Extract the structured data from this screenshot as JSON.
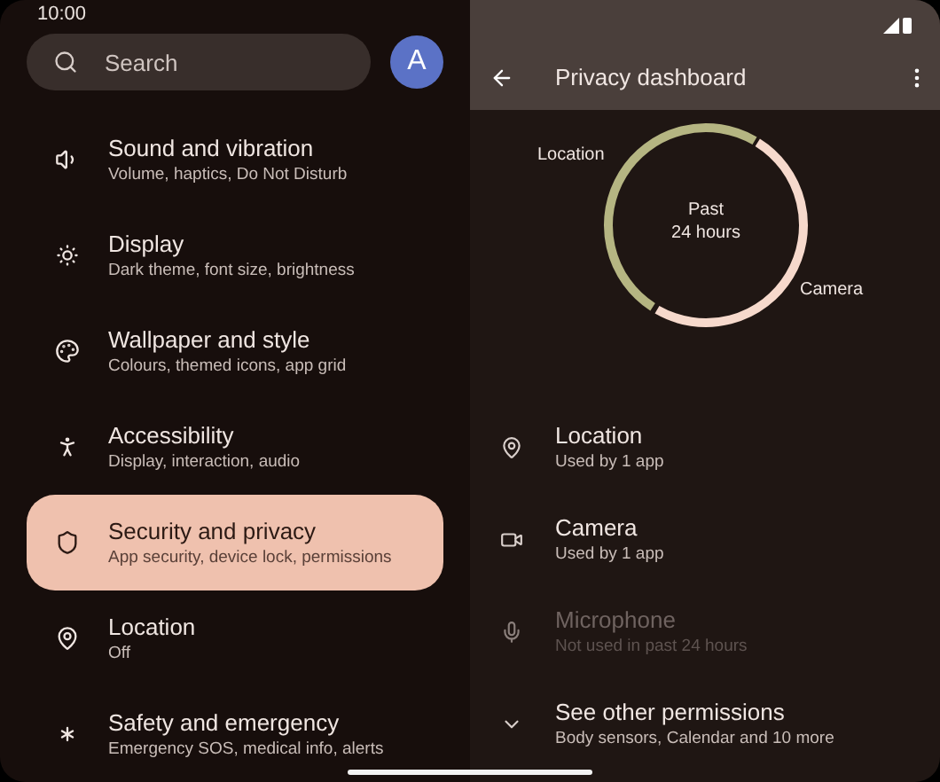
{
  "status_bar": {
    "time": "10:00"
  },
  "search": {
    "placeholder": "Search"
  },
  "avatar": {
    "letter": "A"
  },
  "settings": [
    {
      "title": "Sound and vibration",
      "subtitle": "Volume, haptics, Do Not Disturb",
      "selected": false
    },
    {
      "title": "Display",
      "subtitle": "Dark theme, font size, brightness",
      "selected": false
    },
    {
      "title": "Wallpaper and style",
      "subtitle": "Colours, themed icons, app grid",
      "selected": false
    },
    {
      "title": "Accessibility",
      "subtitle": "Display, interaction, audio",
      "selected": false
    },
    {
      "title": "Security and privacy",
      "subtitle": "App security, device lock, permissions",
      "selected": true
    },
    {
      "title": "Location",
      "subtitle": "Off",
      "selected": false
    },
    {
      "title": "Safety and emergency",
      "subtitle": "Emergency SOS, medical info, alerts",
      "selected": false
    }
  ],
  "detail": {
    "title": "Privacy dashboard",
    "usage_ring": {
      "center_lines": [
        "Past",
        "24 hours"
      ],
      "segments": [
        {
          "label": "Location",
          "color": "#b5b582"
        },
        {
          "label": "Camera",
          "color": "#f6d9cc"
        }
      ]
    },
    "permissions": [
      {
        "title": "Location",
        "subtitle": "Used by 1 app",
        "disabled": false
      },
      {
        "title": "Camera",
        "subtitle": "Used by 1 app",
        "disabled": false
      },
      {
        "title": "Microphone",
        "subtitle": "Not used in past 24 hours",
        "disabled": true
      },
      {
        "title": "See other permissions",
        "subtitle": "Body sensors, Calendar and 10 more",
        "disabled": false
      }
    ]
  }
}
